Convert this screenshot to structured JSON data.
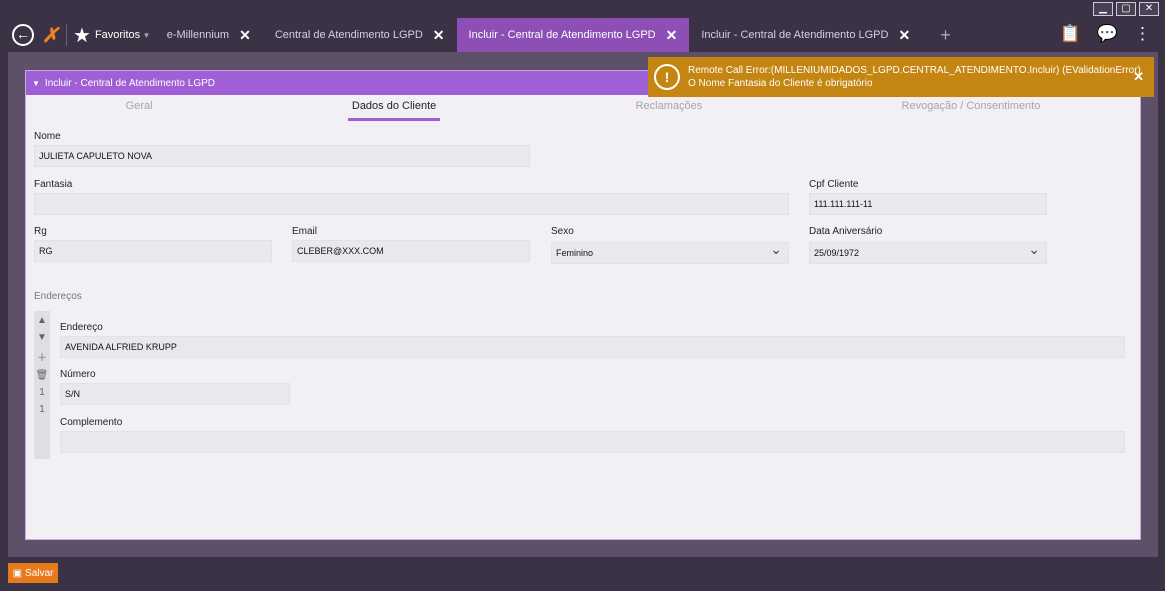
{
  "window": {
    "minimize": "▁",
    "maximize": "▢",
    "close": "✕"
  },
  "topbar": {
    "favorites_label": "Favoritos",
    "tabs": [
      {
        "label": "e-Millennium",
        "close": "✕"
      },
      {
        "label": "Central de Atendimento LGPD",
        "close": "✕"
      },
      {
        "label": "Incluir - Central de Atendimento LGPD",
        "close": "✕"
      },
      {
        "label": "Incluir - Central de Atendimento LGPD",
        "close": "✕"
      }
    ],
    "add_tab": "+"
  },
  "panel": {
    "title": "Incluir - Central de Atendimento LGPD",
    "subtabs": [
      "Geral",
      "Dados do Cliente",
      "Reclamações",
      "Revogação / Consentimento"
    ],
    "active_subtab": "Dados do Cliente"
  },
  "form": {
    "nome_label": "Nome",
    "nome_value": "JULIETA CAPULETO NOVA",
    "fantasia_label": "Fantasia",
    "fantasia_value": "",
    "cpf_label": "Cpf Cliente",
    "cpf_value": "111.111.111-11",
    "rg_label": "Rg",
    "rg_value": "RG",
    "email_label": "Email",
    "email_value": "CLEBER@XXX.COM",
    "sexo_label": "Sexo",
    "sexo_value": "Feminino",
    "aniversario_label": "Data Aniversário",
    "aniversario_value": "25/09/1972"
  },
  "enderecos": {
    "title": "Endereços",
    "endereco_label": "Endereço",
    "endereco_value": "AVENIDA ALFRIED KRUPP",
    "numero_label": "Número",
    "numero_value": "S/N",
    "complemento_label": "Complemento",
    "complemento_value": "",
    "record_index": "1",
    "record_count": "1"
  },
  "toast": {
    "line1": "Remote Call Error:(MILLENIUMIDADOS_LGPD.CENTRAL_ATENDIMENTO.Incluir) (EValidationError)",
    "line2": "O Nome Fantasia do Cliente é obrigatório",
    "close": "✕"
  },
  "footer": {
    "save_label": "Salvar"
  },
  "colors": {
    "accent": "#a05fd6",
    "toast": "#c48512",
    "save": "#e77b1c"
  }
}
